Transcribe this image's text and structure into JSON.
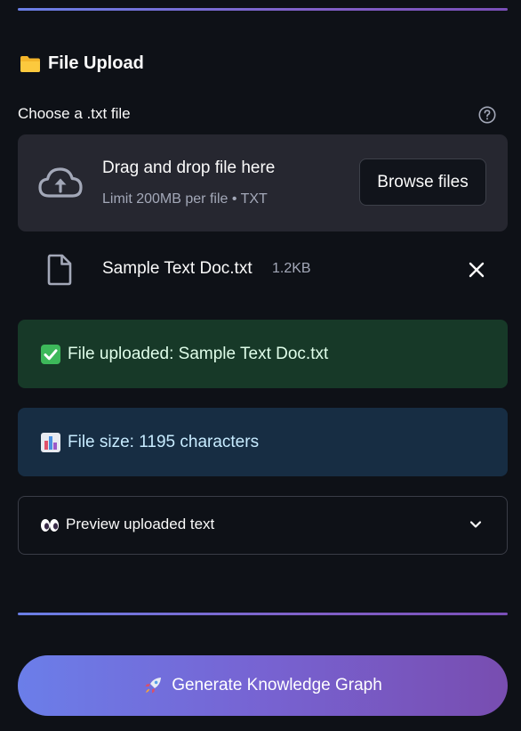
{
  "section": {
    "title": "File Upload",
    "icon": "folder-icon"
  },
  "uploader": {
    "label": "Choose a .txt file",
    "help_icon": "question-circle-icon",
    "drop_title": "Drag and drop file here",
    "drop_sub": "Limit 200MB per file • TXT",
    "browse_label": "Browse files",
    "cloud_icon": "cloud-upload-icon"
  },
  "file": {
    "name": "Sample Text Doc.txt",
    "size": "1.2KB",
    "icon": "document-icon",
    "remove_icon": "close-icon"
  },
  "alerts": {
    "success": "File uploaded: Sample Text Doc.txt",
    "info": "File size: 1195 characters"
  },
  "expander": {
    "label": "Preview uploaded text",
    "icon": "eyes-icon",
    "chevron": "chevron-down-icon"
  },
  "action": {
    "label": "Generate Knowledge Graph",
    "icon": "rocket-icon"
  },
  "colors": {
    "background": "#0e1117",
    "dropzone": "#262730",
    "success_bg": "#173928",
    "info_bg": "#172d43",
    "accent_start": "#6b7ee9",
    "accent_end": "#784db0"
  }
}
